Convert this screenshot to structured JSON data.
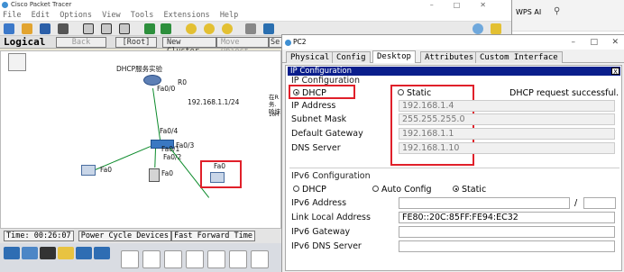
{
  "main_window": {
    "title": "Cisco Packet Tracer",
    "menu": [
      "File",
      "Edit",
      "Options",
      "View",
      "Tools",
      "Extensions",
      "Help"
    ],
    "logical_label": "Logical",
    "logical_buttons": [
      "Back",
      "[Root]",
      "New Cluster",
      "Move Object",
      "Se"
    ],
    "status_time": "Time: 00:26:07",
    "power_cycle_label": "Power Cycle Devices",
    "fast_forward_label": "Fast Forward Time"
  },
  "wps": {
    "label": "WPS AI"
  },
  "topology": {
    "server_title": "DHCP服务实验",
    "router_name": "R0",
    "router_port": "Fa0/0",
    "router_ip": "192.168.1.1/24",
    "switch_up_port": "Fa0/4",
    "switch_port_1": "Fa0/1",
    "switch_port_2": "Fa0/2",
    "switch_port_3": "Fa0/3",
    "pc0_port": "Fa0",
    "pc1_port": "Fa0",
    "pc2_port": "Fa0",
    "side_note": [
      "在R",
      "务.",
      "哈抹",
      "10H"
    ]
  },
  "pc2_window": {
    "title": "PC2",
    "tabs": [
      "Physical",
      "Config",
      "Desktop",
      "Attributes",
      "Custom Interface"
    ],
    "active_tab": "Desktop",
    "ip_config_header": "IP Configuration",
    "ip_config_section": "IP Configuration",
    "dhcp_label": "DHCP",
    "static_label": "Static",
    "dhcp_status": "DHCP request successful.",
    "fields": [
      {
        "label": "IP Address",
        "value": "192.168.1.4"
      },
      {
        "label": "Subnet Mask",
        "value": "255.255.255.0"
      },
      {
        "label": "Default Gateway",
        "value": "192.168.1.1"
      },
      {
        "label": "DNS Server",
        "value": "192.168.1.10"
      }
    ],
    "ipv6_section": "IPv6 Configuration",
    "ipv6_dhcp": "DHCP",
    "ipv6_auto": "Auto Config",
    "ipv6_static": "Static",
    "ipv6_fields": [
      {
        "label": "IPv6 Address",
        "value": ""
      },
      {
        "label": "Link Local Address",
        "value": "FE80::20C:85FF:FE94:EC32"
      },
      {
        "label": "IPv6 Gateway",
        "value": ""
      },
      {
        "label": "IPv6 DNS Server",
        "value": ""
      }
    ],
    "ipv6_prefix_sep": "/"
  },
  "colors": {
    "header_blue": "#0a1e8c",
    "highlight_red": "#e0202a",
    "link_green": "#0b8a2a"
  }
}
